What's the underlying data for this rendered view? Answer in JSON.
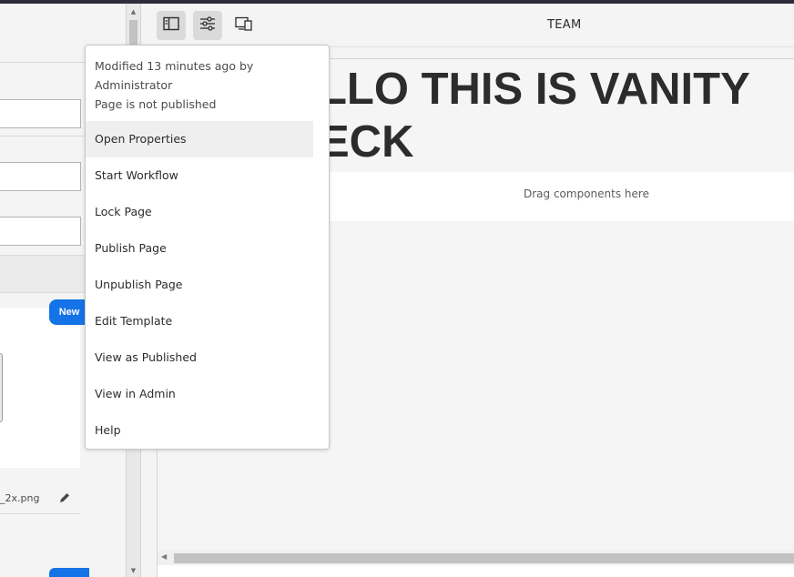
{
  "left_panel": {
    "new_button_label": "New",
    "file_name": "_2x.png"
  },
  "toolbar": {
    "buttons": [
      {
        "icon": "side-panel-toggle-icon"
      },
      {
        "icon": "page-properties-sliders-icon"
      },
      {
        "icon": "emulator-devices-icon"
      }
    ],
    "title": "TEAM"
  },
  "canvas": {
    "headline_line1": "LLO THIS IS VANITY",
    "headline_line2": "ECK",
    "drop_hint": "Drag components here"
  },
  "page_info": {
    "meta": [
      "Modified 13 minutes ago by",
      "Administrator",
      "Page is not published"
    ],
    "menu": [
      "Open Properties",
      "Start Workflow",
      "Lock Page",
      "Publish Page",
      "Unpublish Page",
      "Edit Template",
      "View as Published",
      "View in Admin",
      "Help"
    ],
    "hovered_index": 0
  },
  "colors": {
    "accent": "#1473e6",
    "top_bar": "#2f2b38"
  }
}
